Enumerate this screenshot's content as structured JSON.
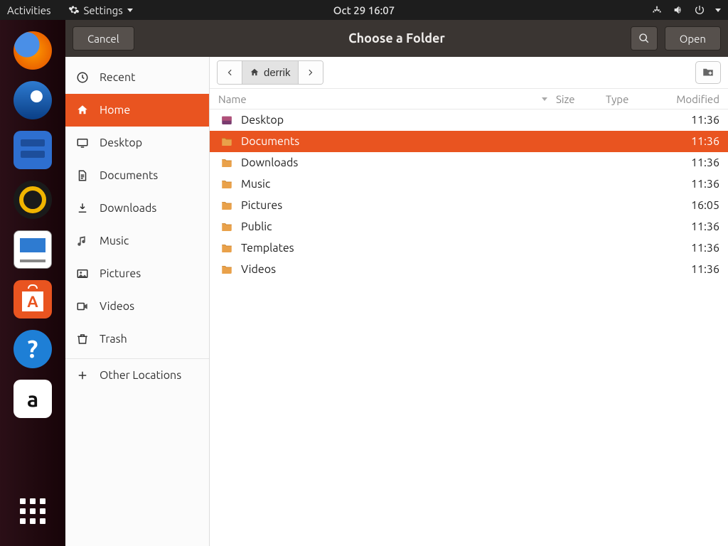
{
  "panel": {
    "activities": "Activities",
    "app_menu": "Settings",
    "clock": "Oct 29  16:07"
  },
  "dialog": {
    "title": "Choose a Folder",
    "cancel": "Cancel",
    "open": "Open"
  },
  "breadcrumb": {
    "current": "derrik"
  },
  "columns": {
    "name": "Name",
    "size": "Size",
    "type": "Type",
    "modified": "Modified"
  },
  "places": [
    {
      "id": "recent",
      "label": "Recent",
      "icon": "clock"
    },
    {
      "id": "home",
      "label": "Home",
      "icon": "home",
      "active": true
    },
    {
      "id": "desktop",
      "label": "Desktop",
      "icon": "desktop"
    },
    {
      "id": "documents",
      "label": "Documents",
      "icon": "doc"
    },
    {
      "id": "downloads",
      "label": "Downloads",
      "icon": "download"
    },
    {
      "id": "music",
      "label": "Music",
      "icon": "music"
    },
    {
      "id": "pictures",
      "label": "Pictures",
      "icon": "pictures"
    },
    {
      "id": "videos",
      "label": "Videos",
      "icon": "videos"
    },
    {
      "id": "trash",
      "label": "Trash",
      "icon": "trash"
    },
    {
      "id": "other",
      "label": "Other Locations",
      "icon": "plus",
      "separator": true
    }
  ],
  "files": [
    {
      "name": "Desktop",
      "modified": "11:36",
      "special": true
    },
    {
      "name": "Documents",
      "modified": "11:36",
      "selected": true
    },
    {
      "name": "Downloads",
      "modified": "11:36"
    },
    {
      "name": "Music",
      "modified": "11:36"
    },
    {
      "name": "Pictures",
      "modified": "16:05"
    },
    {
      "name": "Public",
      "modified": "11:36"
    },
    {
      "name": "Templates",
      "modified": "11:36"
    },
    {
      "name": "Videos",
      "modified": "11:36"
    }
  ]
}
